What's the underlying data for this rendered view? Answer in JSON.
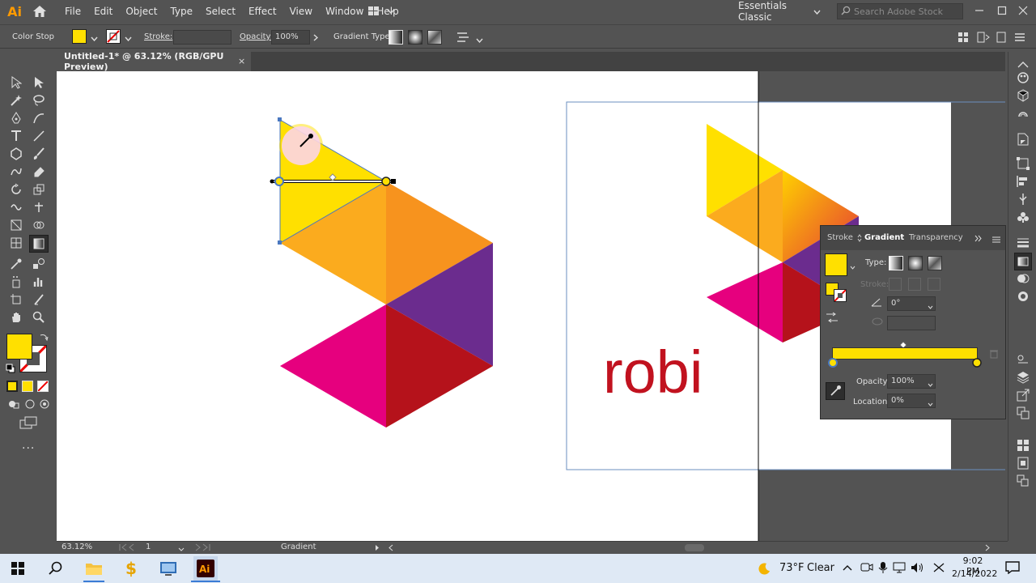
{
  "app": {
    "logo_text": "Ai"
  },
  "menu": [
    "File",
    "Edit",
    "Object",
    "Type",
    "Select",
    "Effect",
    "View",
    "Window",
    "Help"
  ],
  "workspace": "Essentials Classic",
  "search": {
    "placeholder": "Search Adobe Stock"
  },
  "control_bar": {
    "context_label": "Color Stop",
    "stroke_label": "Stroke:",
    "opacity_label": "Opacity:",
    "opacity_value": "100%",
    "gradient_type_label": "Gradient Type:"
  },
  "document_tab": {
    "title": "Untitled-1* @ 63.12% (RGB/GPU Preview)",
    "close": "×"
  },
  "gradient_panel": {
    "tabs": [
      "Stroke",
      "Gradient",
      "Transparency"
    ],
    "type_label": "Type:",
    "stroke_label": "Stroke:",
    "angle_value": "0°",
    "opacity_label": "Opacity:",
    "opacity_value": "100%",
    "location_label": "Location:",
    "location_value": "0%"
  },
  "artwork": {
    "brand_text": "robi"
  },
  "status_bar": {
    "zoom": "63.12%",
    "page": "1",
    "info": "Gradient"
  },
  "taskbar": {
    "temperature": "73°F",
    "weather": "Clear",
    "time": "9:02 PM",
    "date": "2/14/2022"
  },
  "colors": {
    "fill": "#ffe000",
    "yellow": "#ffe000",
    "orange": "#f7931e",
    "purple": "#6b2c8e",
    "magenta": "#e6007e",
    "red": "#c1121f",
    "brand_red": "#c1121f"
  }
}
